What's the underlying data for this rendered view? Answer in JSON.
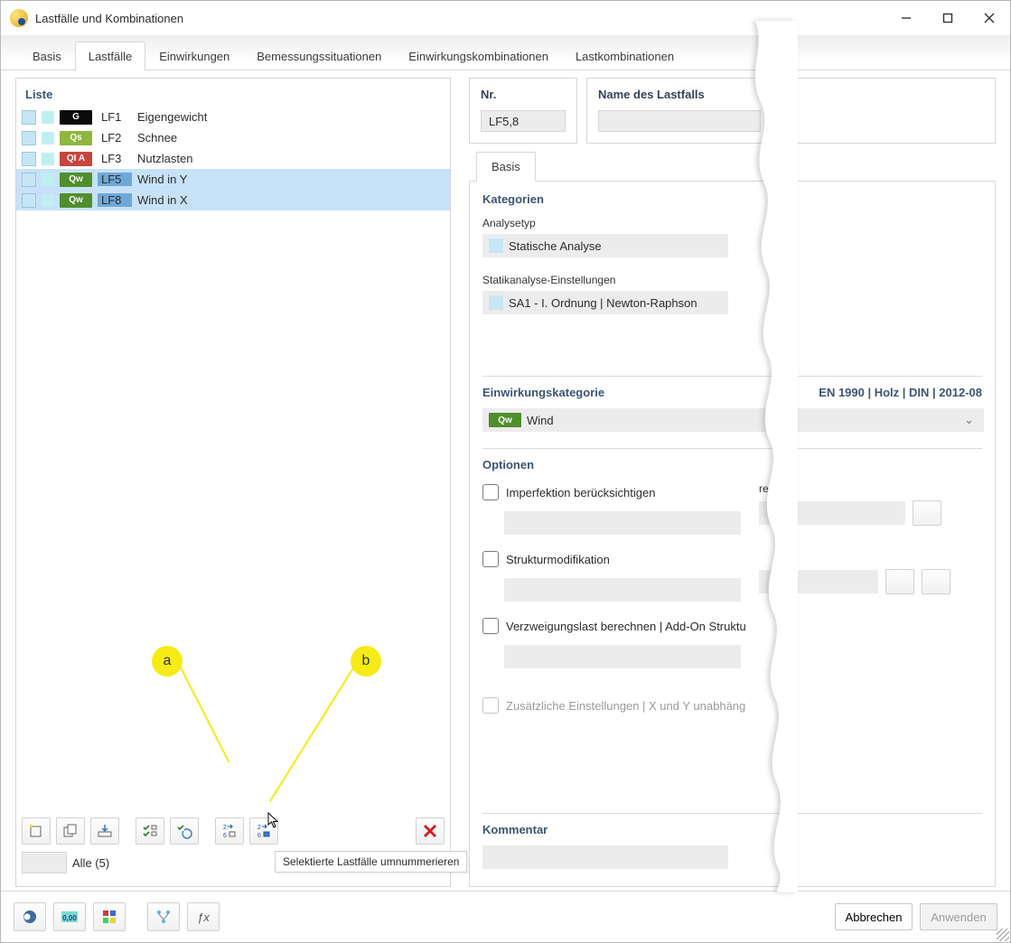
{
  "window": {
    "title": "Lastfälle und Kombinationen"
  },
  "tabs": {
    "items": [
      {
        "label": "Basis"
      },
      {
        "label": "Lastfälle"
      },
      {
        "label": "Einwirkungen"
      },
      {
        "label": "Bemessungssituationen"
      },
      {
        "label": "Einwirkungskombinationen"
      },
      {
        "label": "Lastkombinationen"
      }
    ],
    "active_index": 1
  },
  "list": {
    "title": "Liste",
    "rows": [
      {
        "badge": "G",
        "badge_bg": "#0a0a0a",
        "lf": "LF1",
        "name": "Eigengewicht",
        "selected": false
      },
      {
        "badge": "Qs",
        "badge_bg": "#8fb63d",
        "lf": "LF2",
        "name": "Schnee",
        "selected": false
      },
      {
        "badge": "QI A",
        "badge_bg": "#c8453e",
        "lf": "LF3",
        "name": "Nutzlasten",
        "selected": false
      },
      {
        "badge": "Qw",
        "badge_bg": "#4f8f2e",
        "lf": "LF5",
        "name": "Wind in Y",
        "selected": true
      },
      {
        "badge": "Qw",
        "badge_bg": "#4f8f2e",
        "lf": "LF8",
        "name": "Wind in X",
        "selected": true
      }
    ],
    "filter_label": "Alle (5)",
    "tooltip": "Selektierte Lastfälle umnummerieren"
  },
  "annotations": {
    "a": "a",
    "b": "b"
  },
  "form": {
    "nr": {
      "label": "Nr.",
      "value": "LF5,8"
    },
    "name": {
      "label": "Name des Lastfalls",
      "value": ""
    },
    "sub_tab": "Basis",
    "kategorien": {
      "title": "Kategorien",
      "analysetyp_label": "Analysetyp",
      "analysetyp_value": "Statische Analyse",
      "settings_label": "Statikanalyse-Einstellungen",
      "settings_value": "SA1 - I. Ordnung | Newton-Raphson"
    },
    "einwirkung": {
      "title": "Einwirkungskategorie",
      "standard": "EN 1990 | Holz | DIN | 2012-08",
      "badge": "Qw",
      "badge_bg": "#4f8f2e",
      "value": "Wind"
    },
    "optionen": {
      "title": "Optionen",
      "imperfektion": "Imperfektion berücksichtigen",
      "right_fragment": "ren aus",
      "struktur": "Strukturmodifikation",
      "verzweigung": "Verzweigungslast berechnen | Add-On Struktu",
      "zusatz": "Zusätzliche Einstellungen | X und Y unabhäng"
    },
    "kommentar": {
      "title": "Kommentar"
    }
  },
  "footer": {
    "cancel": "Abbrechen",
    "apply": "Anwenden"
  }
}
